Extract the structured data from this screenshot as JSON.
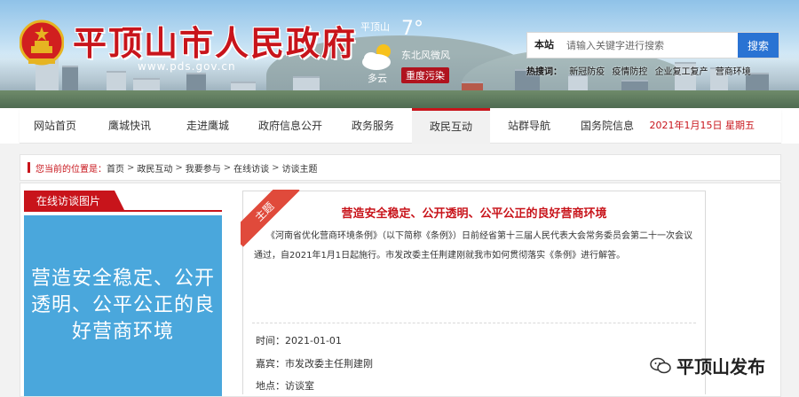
{
  "header": {
    "site_title": "平顶山市人民政府",
    "site_url": "www.pds.gov.cn",
    "weather": {
      "city": "平顶山",
      "temperature": "7°",
      "wind": "东北风微风",
      "description": "多云",
      "aqi": "重度污染"
    },
    "search": {
      "label": "本站",
      "placeholder": "请输入关键字进行搜索",
      "button": "搜索"
    },
    "hot_words": {
      "label": "热搜词：",
      "items": [
        "新冠防疫",
        "疫情防控",
        "企业复工复产",
        "营商环境"
      ]
    }
  },
  "nav": {
    "items": [
      "网站首页",
      "鹰城快讯",
      "走进鹰城",
      "政府信息公开",
      "政务服务",
      "政民互动",
      "站群导航",
      "国务院信息"
    ],
    "active_index": 5,
    "date": "2021年1月15日 星期五"
  },
  "breadcrumb": {
    "lead": "您当前的位置是：",
    "items": [
      "首页",
      "政民互动",
      "我要参与",
      "在线访谈",
      "访谈主题"
    ]
  },
  "left_panel": {
    "title": "在线访谈图片",
    "image_text": "营造安全稳定、公开透明、公平公正的良好营商环境"
  },
  "topic": {
    "ribbon": "主题",
    "title": "营造安全稳定、公开透明、公平公正的良好营商环境",
    "body": "《河南省优化营商环境条例》（以下简称《条例》）日前经省第十三届人民代表大会常务委员会第二十一次会议通过，自2021年1月1日起施行。市发改委主任荆建刚就我市如何贯彻落实《条例》进行解答。",
    "time_label": "时间：",
    "time": "2021-01-01",
    "guest_label": "嘉宾：",
    "guest": "市发改委主任荆建刚",
    "place_label": "地点：",
    "place": "访谈室"
  },
  "watermark": {
    "text": "平顶山发布"
  },
  "colors": {
    "brand_red": "#c8141b",
    "search_blue": "#2a73d3",
    "panel_blue": "#4aa7dc"
  }
}
